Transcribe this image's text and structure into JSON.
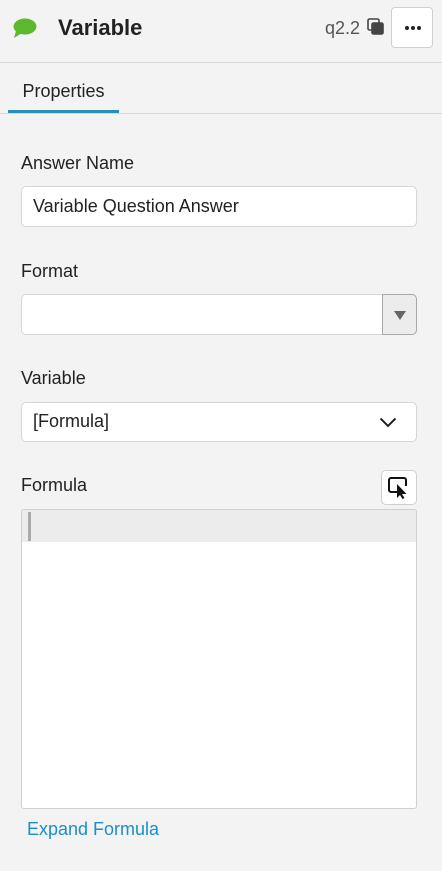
{
  "header": {
    "icon": "chat-bubble-icon",
    "title": "Variable",
    "question_id": "q2.2",
    "copy_icon": "copy-icon",
    "more_icon": "ellipsis-icon"
  },
  "tabs": [
    {
      "label": "Properties",
      "active": true
    }
  ],
  "fields": {
    "answer_name": {
      "label": "Answer Name",
      "value": "Variable Question Answer"
    },
    "format": {
      "label": "Format",
      "value": ""
    },
    "variable": {
      "label": "Variable",
      "value": "[Formula]"
    },
    "formula": {
      "label": "Formula",
      "value": "",
      "picker_icon": "cursor-select-icon"
    }
  },
  "expand_link": "Expand Formula",
  "colors": {
    "accent": "#2a8fb3",
    "link": "#1a8fc9",
    "icon_green": "#5cb82e",
    "background": "#f3f3f3"
  }
}
